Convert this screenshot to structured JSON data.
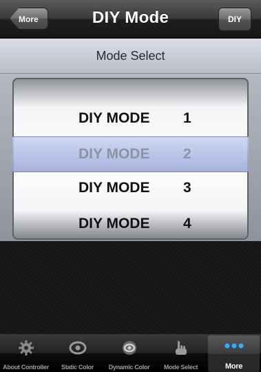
{
  "navbar": {
    "title": "DIY Mode",
    "back_label": "More",
    "right_label": "DIY"
  },
  "header": {
    "title": "Mode Select"
  },
  "picker": {
    "rows": [
      {
        "label": "DIY MODE",
        "num": "1"
      },
      {
        "label": "DIY MODE",
        "num": "3"
      },
      {
        "label": "DIY MODE",
        "num": "4"
      }
    ],
    "selected": {
      "label": "DIY MODE",
      "num": "2"
    }
  },
  "tabbar": {
    "tabs": [
      {
        "label": "About Controller",
        "icon": "gear-icon"
      },
      {
        "label": "Static Color",
        "icon": "eye-icon"
      },
      {
        "label": "Dynamic Color",
        "icon": "eye-icon"
      },
      {
        "label": "Mode Select",
        "icon": "hand-icon"
      },
      {
        "label": "More",
        "icon": "dots-icon"
      }
    ],
    "active_index": 4
  }
}
